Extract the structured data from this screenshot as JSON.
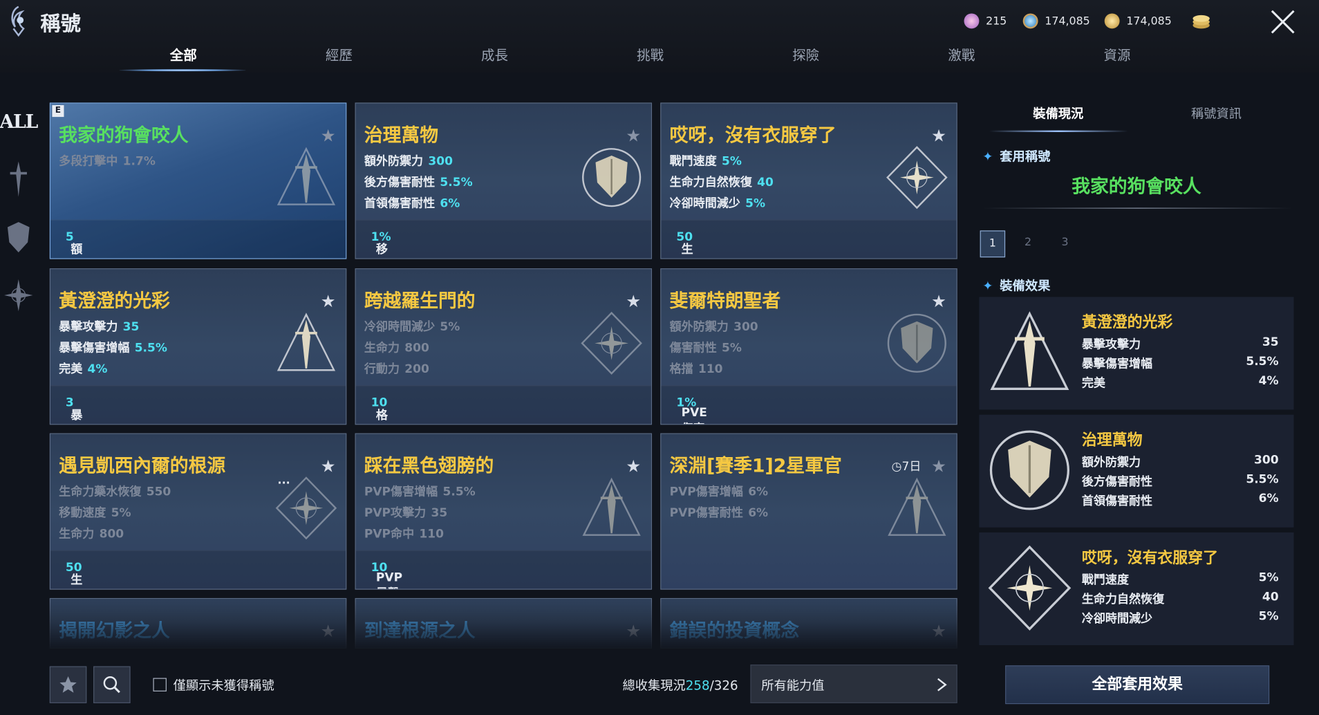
{
  "header": {
    "title": "稱號",
    "currencies": [
      {
        "icon": "pink-crystal-icon",
        "value": "215"
      },
      {
        "icon": "blue-coin-icon",
        "value": "174,085"
      },
      {
        "icon": "gold-coin-icon",
        "value": "174,085"
      },
      {
        "icon": "coin-stack-icon",
        "value": ""
      }
    ]
  },
  "tabs": [
    "全部",
    "經歷",
    "成長",
    "挑戰",
    "探險",
    "激戰",
    "資源"
  ],
  "sidebar": {
    "all_label": "ALL"
  },
  "cards": [
    {
      "title": "我家的狗會咬人",
      "color": "green",
      "badge": "E",
      "stats": [
        {
          "name": "多段打擊中",
          "value": "1.7%",
          "dim": true
        }
      ],
      "bottom": {
        "name": "額外命中",
        "value": "5"
      },
      "starred": false,
      "emblem": "sword"
    },
    {
      "title": "治理萬物",
      "color": "yellow",
      "stats": [
        {
          "name": "額外防禦力",
          "value": "300"
        },
        {
          "name": "後方傷害耐性",
          "value": "5.5%"
        },
        {
          "name": "首領傷害耐性",
          "value": "6%"
        }
      ],
      "bottom": {
        "name": "移動速度",
        "value": "1%"
      },
      "starred": false,
      "emblem": "shield"
    },
    {
      "title": "哎呀，沒有衣服穿了",
      "color": "yellow",
      "stats": [
        {
          "name": "戰鬥速度",
          "value": "5%"
        },
        {
          "name": "生命力自然恢復",
          "value": "40"
        },
        {
          "name": "冷卻時間減少",
          "value": "5%"
        }
      ],
      "bottom": {
        "name": "生命力",
        "value": "50"
      },
      "starred": true,
      "emblem": "starburst"
    },
    {
      "title": "黃澄澄的光彩",
      "color": "yellow",
      "stats": [
        {
          "name": "暴擊攻擊力",
          "value": "35"
        },
        {
          "name": "暴擊傷害增幅",
          "value": "5.5%"
        },
        {
          "name": "完美",
          "value": "4%"
        }
      ],
      "bottom": {
        "name": "暴擊攻擊力",
        "value": "3"
      },
      "starred": true,
      "emblem": "sword"
    },
    {
      "title": "跨越羅生門的",
      "color": "yellow",
      "stats": [
        {
          "name": "冷卻時間減少",
          "value": "5%",
          "dim": true
        },
        {
          "name": "生命力",
          "value": "800",
          "dim": true
        },
        {
          "name": "行動力",
          "value": "200",
          "dim": true
        }
      ],
      "bottom": {
        "name": "格擋",
        "value": "10"
      },
      "starred": true,
      "emblem": "starburst"
    },
    {
      "title": "斐爾特朗聖者",
      "color": "yellow",
      "stats": [
        {
          "name": "額外防禦力",
          "value": "300",
          "dim": true
        },
        {
          "name": "傷害耐性",
          "value": "5%",
          "dim": true
        },
        {
          "name": "格擋",
          "value": "110",
          "dim": true
        }
      ],
      "bottom": {
        "name": "PVE傷害耐性",
        "value": "1%"
      },
      "starred": true,
      "emblem": "shield"
    },
    {
      "title": "遇見凱西內爾的根源",
      "color": "yellow",
      "stats": [
        {
          "name": "生命力藥水恢復",
          "value": "550",
          "dim": true
        },
        {
          "name": "移動速度",
          "value": "5%",
          "dim": true
        },
        {
          "name": "生命力",
          "value": "800",
          "dim": true
        }
      ],
      "bottom": {
        "name": "生命力",
        "value": "50"
      },
      "starred": true,
      "emblem": "starburst",
      "more": "..."
    },
    {
      "title": "踩在黑色翅膀的",
      "color": "yellow",
      "stats": [
        {
          "name": "PVP傷害增幅",
          "value": "5.5%",
          "dim": true
        },
        {
          "name": "PVP攻擊力",
          "value": "35",
          "dim": true
        },
        {
          "name": "PVP命中",
          "value": "110",
          "dim": true
        }
      ],
      "bottom": {
        "name": "PVP暴擊",
        "value": "10"
      },
      "starred": true,
      "emblem": "sword"
    },
    {
      "title": "深淵[賽季1]2星軍官",
      "color": "yellow",
      "timer": "7日",
      "stats": [
        {
          "name": "PVP傷害增幅",
          "value": "6%",
          "dim": true
        },
        {
          "name": "PVP傷害耐性",
          "value": "6%",
          "dim": true
        }
      ],
      "bottom": null,
      "starred": false,
      "emblem": "sword"
    },
    {
      "title": "揭開幻影之人",
      "color": "blue",
      "stats": [],
      "bottom": null,
      "starred": false
    },
    {
      "title": "到達根源之人",
      "color": "blue",
      "stats": [],
      "bottom": null,
      "starred": false
    },
    {
      "title": "錯誤的投資概念",
      "color": "blue",
      "stats": [],
      "bottom": null,
      "starred": false
    }
  ],
  "footer": {
    "checkbox_label": "僅顯示未獲得稱號",
    "total_label": "總收集現況",
    "total_count": "258",
    "total_max": "/326",
    "filter": "所有能力值",
    "apply_all": "全部套用效果"
  },
  "right": {
    "tabs": [
      "裝備現況",
      "稱號資訊"
    ],
    "applied_label": "套用稱號",
    "applied_title": "我家的狗會咬人",
    "pages": [
      "1",
      "2",
      "3"
    ],
    "effects_label": "裝備效果",
    "effects": [
      {
        "title": "黃澄澄的光彩",
        "emblem": "sword",
        "rows": [
          {
            "name": "暴擊攻擊力",
            "value": "35"
          },
          {
            "name": "暴擊傷害增幅",
            "value": "5.5%"
          },
          {
            "name": "完美",
            "value": "4%"
          }
        ]
      },
      {
        "title": "治理萬物",
        "emblem": "shield",
        "rows": [
          {
            "name": "額外防禦力",
            "value": "300"
          },
          {
            "name": "後方傷害耐性",
            "value": "5.5%"
          },
          {
            "name": "首領傷害耐性",
            "value": "6%"
          }
        ]
      },
      {
        "title": "哎呀，沒有衣服穿了",
        "emblem": "starburst",
        "rows": [
          {
            "name": "戰鬥速度",
            "value": "5%"
          },
          {
            "name": "生命力自然恢復",
            "value": "40"
          },
          {
            "name": "冷卻時間減少",
            "value": "5%"
          }
        ]
      }
    ]
  }
}
